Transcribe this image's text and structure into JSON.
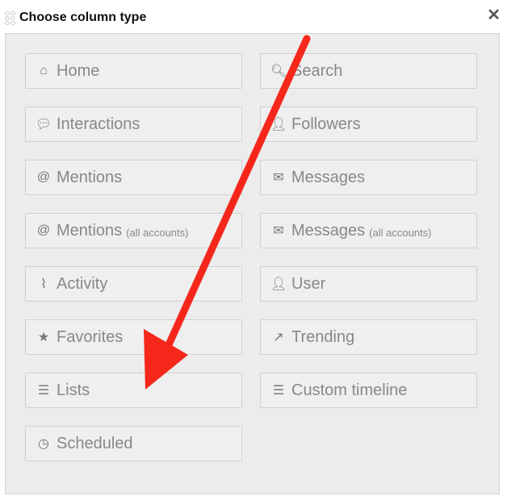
{
  "dialog": {
    "title": "Choose column type",
    "close_icon": "close-icon"
  },
  "buttons": [
    {
      "label": "Home",
      "icon": "home-icon",
      "glyph": "⌂"
    },
    {
      "label": "Search",
      "icon": "search-icon",
      "glyph": "🔍︎"
    },
    {
      "label": "Interactions",
      "icon": "speech-bubbles-icon",
      "glyph": "💬︎"
    },
    {
      "label": "Followers",
      "icon": "user-plus-icon",
      "glyph": "👤︎"
    },
    {
      "label": "Mentions",
      "icon": "at-icon",
      "glyph": "@"
    },
    {
      "label": "Messages",
      "icon": "envelope-icon",
      "glyph": "✉"
    },
    {
      "label": "Mentions",
      "sub": "(all accounts)",
      "icon": "at-icon",
      "glyph": "@"
    },
    {
      "label": "Messages",
      "sub": "(all accounts)",
      "icon": "envelope-icon",
      "glyph": "✉"
    },
    {
      "label": "Activity",
      "icon": "activity-icon",
      "glyph": "⌇"
    },
    {
      "label": "User",
      "icon": "user-icon",
      "glyph": "👤︎"
    },
    {
      "label": "Favorites",
      "icon": "star-icon",
      "glyph": "★"
    },
    {
      "label": "Trending",
      "icon": "trending-icon",
      "glyph": "↗"
    },
    {
      "label": "Lists",
      "icon": "list-icon",
      "glyph": "☰"
    },
    {
      "label": "Custom timeline",
      "icon": "custom-timeline-icon",
      "glyph": "☰"
    },
    {
      "label": "Scheduled",
      "icon": "clock-icon",
      "glyph": "◷"
    }
  ],
  "colors": {
    "annotation_arrow": "#f5271b"
  }
}
